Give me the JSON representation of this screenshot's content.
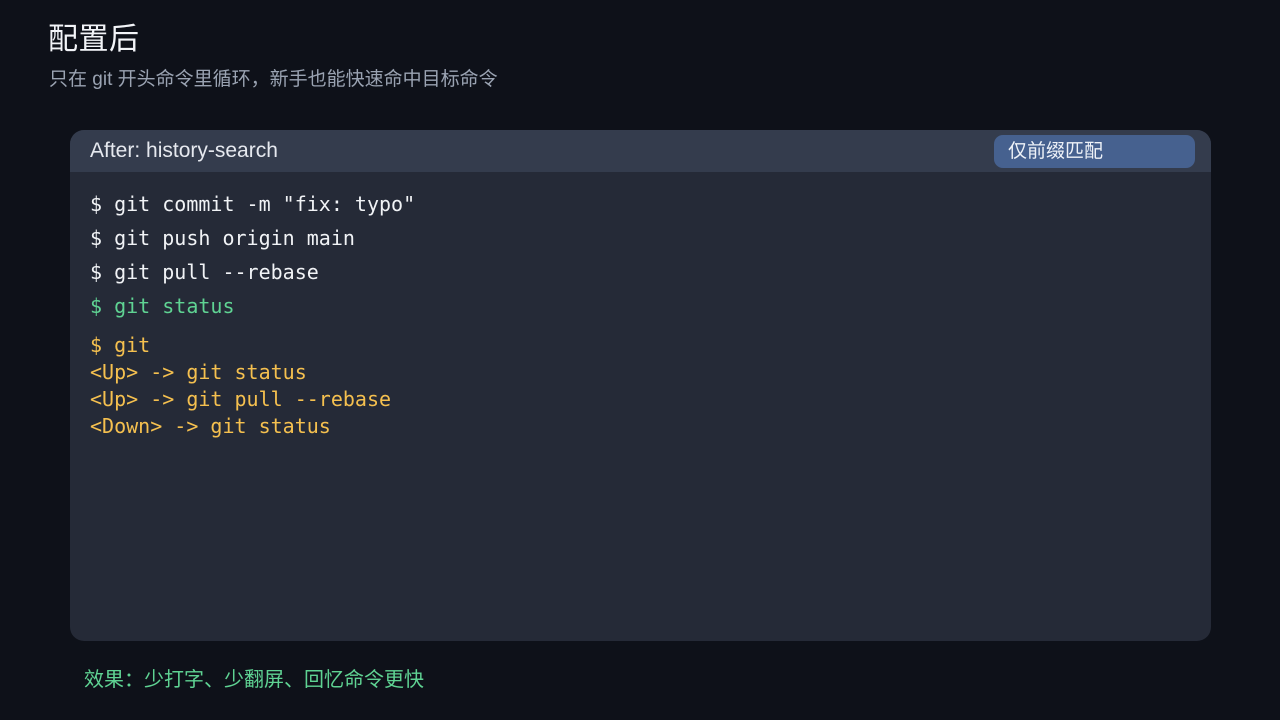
{
  "header": {
    "title": "配置后",
    "subtitle": "只在 git 开头命令里循环，新手也能快速命中目标命令"
  },
  "terminal": {
    "title": "After: history-search",
    "badge": "仅前缀匹配",
    "history": [
      "$ git commit -m \"fix: typo\"",
      "$ git push origin main",
      "$ git pull --rebase",
      "$ git status"
    ],
    "demo": {
      "prompt": "$ git",
      "steps": [
        "<Up> -> git status",
        "<Up> -> git pull --rebase",
        "<Down> -> git status"
      ]
    }
  },
  "footer": {
    "note": "效果：少打字、少翻屏、回忆命令更快"
  },
  "colors": {
    "background": "#0e1119",
    "terminal_body": "#252a37",
    "terminal_header": "#343c4d",
    "badge": "#46618f",
    "match_green": "#5fd393",
    "key_yellow": "#f5c04f"
  }
}
